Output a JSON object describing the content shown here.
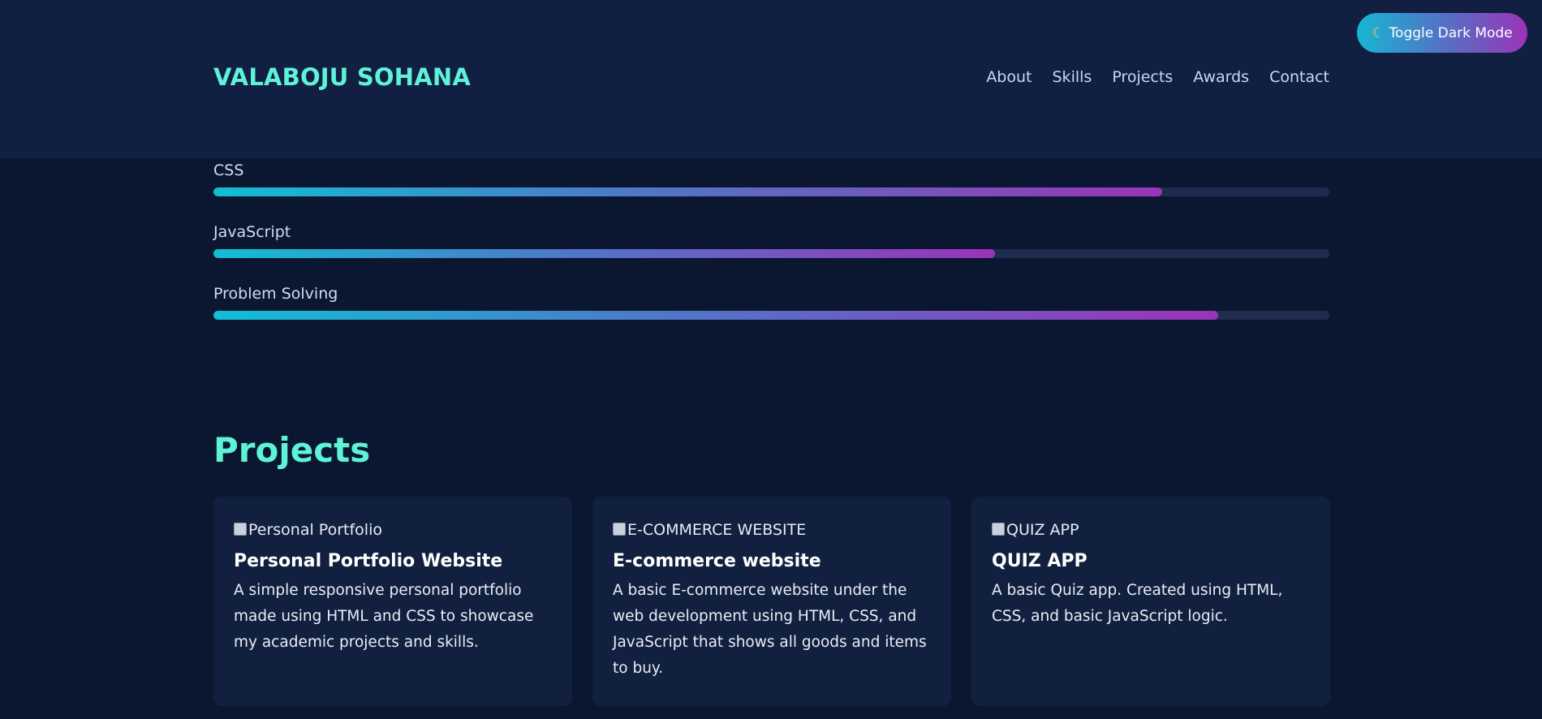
{
  "header": {
    "brand": "VALABOJU SOHANA",
    "nav": [
      "About",
      "Skills",
      "Projects",
      "Awards",
      "Contact"
    ]
  },
  "toggle": {
    "icon": "moon-icon",
    "label": "Toggle Dark Mode"
  },
  "skills": [
    {
      "name": "CSS",
      "percent": 85
    },
    {
      "name": "JavaScript",
      "percent": 70
    },
    {
      "name": "Problem Solving",
      "percent": 90
    }
  ],
  "projects": {
    "title": "Projects",
    "items": [
      {
        "image_alt": "Personal Portfolio",
        "title": "Personal Portfolio Website",
        "description": "A simple responsive personal portfolio made using HTML and CSS to showcase my academic projects and skills."
      },
      {
        "image_alt": "E-COMMERCE WEBSITE",
        "title": "E-commerce website",
        "description": "A basic E-commerce website under the web development using HTML, CSS, and JavaScript that shows all goods and items to buy."
      },
      {
        "image_alt": "QUIZ APP",
        "title": "QUIZ APP",
        "description": "A basic Quiz app. Created using HTML, CSS, and basic JavaScript logic."
      }
    ]
  },
  "colors": {
    "background": "#0b1730",
    "header": "#111f42",
    "accent": "#5ef2d6",
    "card": "#12203f",
    "gradient_start": "#12bed4",
    "gradient_end": "#9a34b8"
  }
}
